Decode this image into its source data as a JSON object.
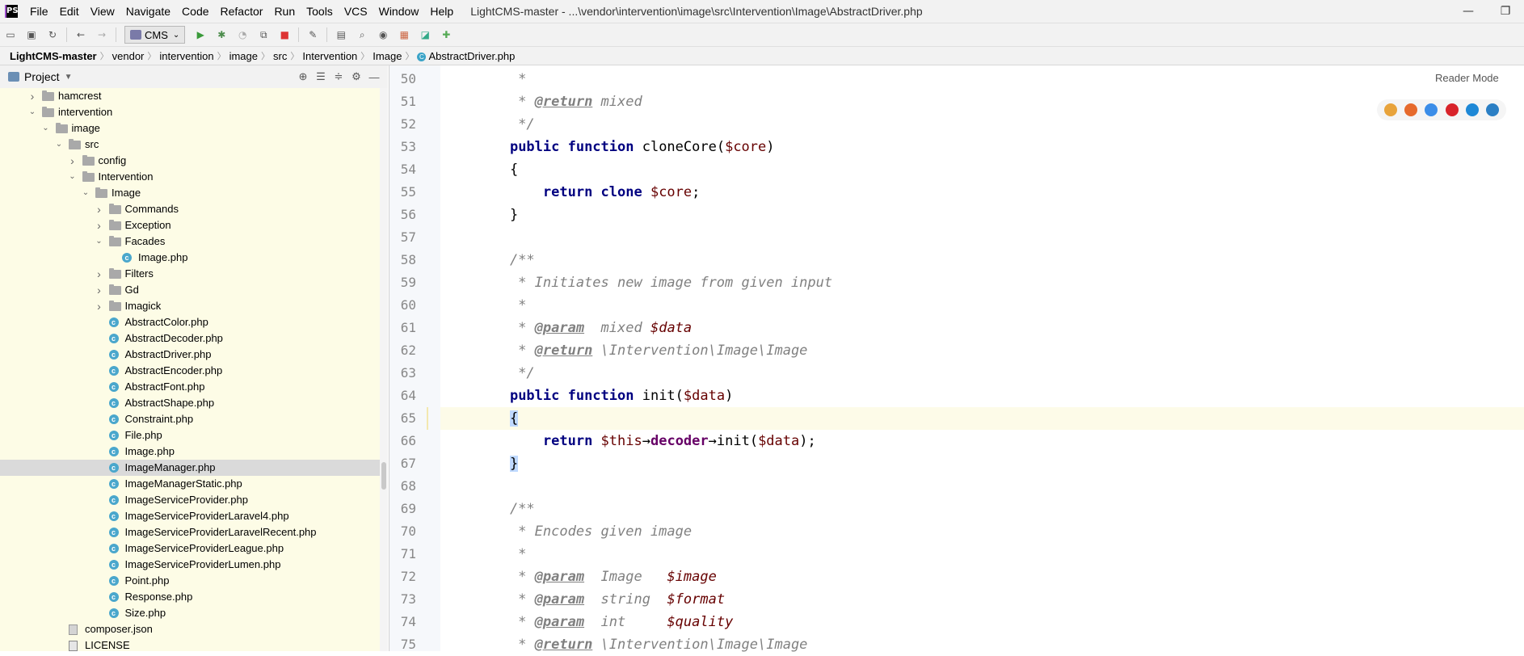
{
  "app": {
    "logo": "PS",
    "title": "LightCMS-master - ...\\vendor\\intervention\\image\\src\\Intervention\\Image\\AbstractDriver.php"
  },
  "menu": [
    "File",
    "Edit",
    "View",
    "Navigate",
    "Code",
    "Refactor",
    "Run",
    "Tools",
    "VCS",
    "Window",
    "Help"
  ],
  "toolbar": {
    "run_config": "CMS"
  },
  "breadcrumb": [
    "LightCMS-master",
    "vendor",
    "intervention",
    "image",
    "src",
    "Intervention",
    "Image",
    "AbstractDriver.php"
  ],
  "project": {
    "title": "Project"
  },
  "tree": [
    {
      "label": "hamcrest",
      "type": "folder",
      "depth": 2,
      "expanded": false
    },
    {
      "label": "intervention",
      "type": "folder",
      "depth": 2,
      "expanded": true
    },
    {
      "label": "image",
      "type": "folder",
      "depth": 3,
      "expanded": true
    },
    {
      "label": "src",
      "type": "folder",
      "depth": 4,
      "expanded": true
    },
    {
      "label": "config",
      "type": "folder",
      "depth": 5,
      "expanded": false
    },
    {
      "label": "Intervention",
      "type": "folder",
      "depth": 5,
      "expanded": true
    },
    {
      "label": "Image",
      "type": "folder",
      "depth": 6,
      "expanded": true
    },
    {
      "label": "Commands",
      "type": "folder",
      "depth": 7,
      "expanded": false
    },
    {
      "label": "Exception",
      "type": "folder",
      "depth": 7,
      "expanded": false
    },
    {
      "label": "Facades",
      "type": "folder",
      "depth": 7,
      "expanded": true
    },
    {
      "label": "Image.php",
      "type": "class",
      "depth": 8
    },
    {
      "label": "Filters",
      "type": "folder",
      "depth": 7,
      "expanded": false
    },
    {
      "label": "Gd",
      "type": "folder",
      "depth": 7,
      "expanded": false
    },
    {
      "label": "Imagick",
      "type": "folder",
      "depth": 7,
      "expanded": false
    },
    {
      "label": "AbstractColor.php",
      "type": "class",
      "depth": 7
    },
    {
      "label": "AbstractDecoder.php",
      "type": "class",
      "depth": 7
    },
    {
      "label": "AbstractDriver.php",
      "type": "class",
      "depth": 7
    },
    {
      "label": "AbstractEncoder.php",
      "type": "class",
      "depth": 7
    },
    {
      "label": "AbstractFont.php",
      "type": "class",
      "depth": 7
    },
    {
      "label": "AbstractShape.php",
      "type": "class",
      "depth": 7
    },
    {
      "label": "Constraint.php",
      "type": "class",
      "depth": 7
    },
    {
      "label": "File.php",
      "type": "class",
      "depth": 7
    },
    {
      "label": "Image.php",
      "type": "class",
      "depth": 7
    },
    {
      "label": "ImageManager.php",
      "type": "class",
      "depth": 7,
      "selected": true
    },
    {
      "label": "ImageManagerStatic.php",
      "type": "class",
      "depth": 7
    },
    {
      "label": "ImageServiceProvider.php",
      "type": "class",
      "depth": 7
    },
    {
      "label": "ImageServiceProviderLaravel4.php",
      "type": "class",
      "depth": 7
    },
    {
      "label": "ImageServiceProviderLaravelRecent.php",
      "type": "class",
      "depth": 7
    },
    {
      "label": "ImageServiceProviderLeague.php",
      "type": "class",
      "depth": 7
    },
    {
      "label": "ImageServiceProviderLumen.php",
      "type": "class",
      "depth": 7
    },
    {
      "label": "Point.php",
      "type": "class",
      "depth": 7
    },
    {
      "label": "Response.php",
      "type": "class",
      "depth": 7
    },
    {
      "label": "Size.php",
      "type": "class",
      "depth": 7
    },
    {
      "label": "composer.json",
      "type": "json",
      "depth": 4
    },
    {
      "label": "LICENSE",
      "type": "license",
      "depth": 4
    }
  ],
  "editor": {
    "reader_mode": "Reader Mode",
    "current_line": 65,
    "lines": [
      {
        "n": 50,
        "t": [
          [
            "cmt",
            "     *"
          ]
        ]
      },
      {
        "n": 51,
        "t": [
          [
            "cmt",
            "     * "
          ],
          [
            "tag",
            "@return"
          ],
          [
            "cmt",
            " mixed"
          ]
        ]
      },
      {
        "n": 52,
        "t": [
          [
            "cmt",
            "     */"
          ]
        ]
      },
      {
        "n": 53,
        "t": [
          [
            "",
            "    "
          ],
          [
            "kw",
            "public function "
          ],
          [
            "fn",
            "cloneCore("
          ],
          [
            "var",
            "$core"
          ],
          [
            "fn",
            ")"
          ]
        ]
      },
      {
        "n": 54,
        "t": [
          [
            "",
            "    {"
          ]
        ]
      },
      {
        "n": 55,
        "t": [
          [
            "",
            "        "
          ],
          [
            "kw",
            "return clone "
          ],
          [
            "var",
            "$core"
          ],
          [
            "",
            ";"
          ]
        ]
      },
      {
        "n": 56,
        "t": [
          [
            "",
            "    }"
          ]
        ]
      },
      {
        "n": 57,
        "t": []
      },
      {
        "n": 58,
        "t": [
          [
            "cmt",
            "    /**"
          ]
        ]
      },
      {
        "n": 59,
        "t": [
          [
            "cmt",
            "     * Initiates new image from given input"
          ]
        ]
      },
      {
        "n": 60,
        "t": [
          [
            "cmt",
            "     *"
          ]
        ]
      },
      {
        "n": 61,
        "t": [
          [
            "cmt",
            "     * "
          ],
          [
            "tag",
            "@param"
          ],
          [
            "cmt",
            "  mixed "
          ],
          [
            "pvar",
            "$data"
          ]
        ]
      },
      {
        "n": 62,
        "t": [
          [
            "cmt",
            "     * "
          ],
          [
            "tag",
            "@return"
          ],
          [
            "cmt",
            " \\Intervention\\Image\\Image"
          ]
        ]
      },
      {
        "n": 63,
        "t": [
          [
            "cmt",
            "     */"
          ]
        ]
      },
      {
        "n": 64,
        "t": [
          [
            "",
            "    "
          ],
          [
            "kw",
            "public function "
          ],
          [
            "fn",
            "init("
          ],
          [
            "var",
            "$data"
          ],
          [
            "fn",
            ")"
          ]
        ]
      },
      {
        "n": 65,
        "t": [
          [
            "",
            "    "
          ],
          [
            "brace-hl",
            "{"
          ]
        ]
      },
      {
        "n": 66,
        "t": [
          [
            "",
            "        "
          ],
          [
            "kw",
            "return "
          ],
          [
            "var",
            "$this"
          ],
          [
            "",
            "→"
          ],
          [
            "prop",
            "decoder"
          ],
          [
            "",
            "→init("
          ],
          [
            "var",
            "$data"
          ],
          [
            "",
            ");"
          ]
        ]
      },
      {
        "n": 67,
        "t": [
          [
            "",
            "    "
          ],
          [
            "brace-hl",
            "}"
          ]
        ]
      },
      {
        "n": 68,
        "t": []
      },
      {
        "n": 69,
        "t": [
          [
            "cmt",
            "    /**"
          ]
        ]
      },
      {
        "n": 70,
        "t": [
          [
            "cmt",
            "     * Encodes given image"
          ]
        ]
      },
      {
        "n": 71,
        "t": [
          [
            "cmt",
            "     *"
          ]
        ]
      },
      {
        "n": 72,
        "t": [
          [
            "cmt",
            "     * "
          ],
          [
            "tag",
            "@param"
          ],
          [
            "cmt",
            "  Image   "
          ],
          [
            "pvar",
            "$image"
          ]
        ]
      },
      {
        "n": 73,
        "t": [
          [
            "cmt",
            "     * "
          ],
          [
            "tag",
            "@param"
          ],
          [
            "cmt",
            "  string  "
          ],
          [
            "pvar",
            "$format"
          ]
        ]
      },
      {
        "n": 74,
        "t": [
          [
            "cmt",
            "     * "
          ],
          [
            "tag",
            "@param"
          ],
          [
            "cmt",
            "  int     "
          ],
          [
            "pvar",
            "$quality"
          ]
        ]
      },
      {
        "n": 75,
        "t": [
          [
            "cmt",
            "     * "
          ],
          [
            "tag",
            "@return"
          ],
          [
            "cmt",
            " \\Intervention\\Image\\Image"
          ]
        ]
      }
    ]
  },
  "browsers": [
    {
      "name": "chrome-icon",
      "color": "#e8a33b"
    },
    {
      "name": "firefox-icon",
      "color": "#e66a2c"
    },
    {
      "name": "safari-icon",
      "color": "#3b8de8"
    },
    {
      "name": "opera-icon",
      "color": "#d8232a"
    },
    {
      "name": "ie-icon",
      "color": "#1e88d6"
    },
    {
      "name": "edge-icon",
      "color": "#2b7fc4"
    }
  ]
}
